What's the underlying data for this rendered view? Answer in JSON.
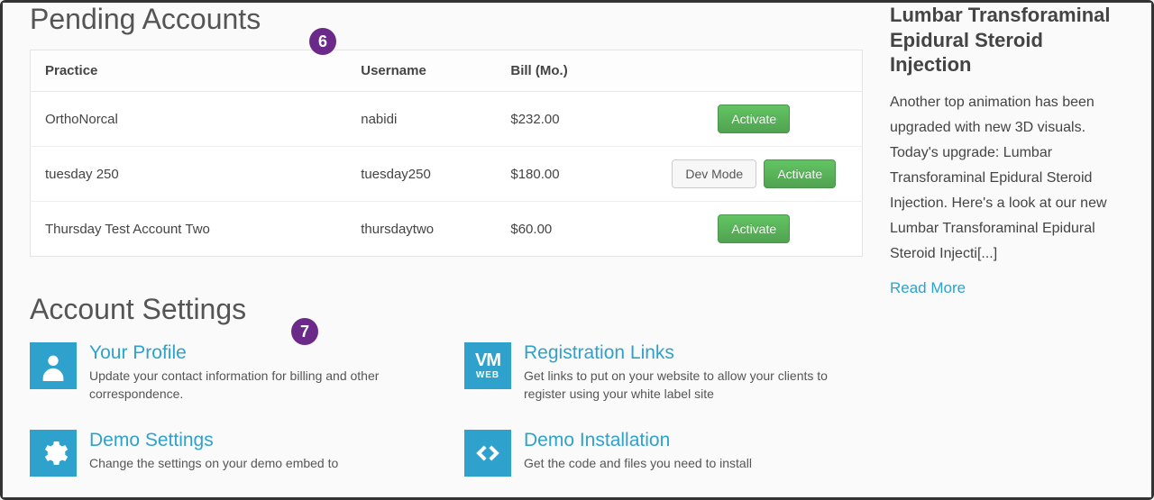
{
  "pending": {
    "title": "Pending Accounts",
    "badge": "6",
    "columns": {
      "practice": "Practice",
      "username": "Username",
      "bill": "Bill (Mo.)"
    },
    "rows": [
      {
        "practice": "OrthoNorcal",
        "username": "nabidi",
        "bill": "$232.00",
        "dev_mode": false
      },
      {
        "practice": "tuesday 250",
        "username": "tuesday250",
        "bill": "$180.00",
        "dev_mode": true
      },
      {
        "practice": "Thursday Test Account Two",
        "username": "thursdaytwo",
        "bill": "$60.00",
        "dev_mode": false
      }
    ],
    "buttons": {
      "activate": "Activate",
      "dev_mode": "Dev Mode"
    }
  },
  "settings": {
    "title": "Account Settings",
    "badge": "7",
    "items": [
      {
        "title": "Your Profile",
        "desc": "Update your contact information for billing and other correspondence."
      },
      {
        "title": "Registration Links",
        "desc": "Get links to put on your website to allow your clients to register using your white label site"
      },
      {
        "title": "Demo Settings",
        "desc": "Change the settings on your demo embed to"
      },
      {
        "title": "Demo Installation",
        "desc": "Get the code and files you need to install"
      }
    ]
  },
  "sidebar": {
    "post_title": "Lumbar Transforaminal Epidural Steroid Injection",
    "post_excerpt": "Another top animation has been upgraded with new 3D visuals. Today's upgrade: Lumbar Transforaminal Epidural Steroid Injection. Here's a look at our new Lumbar Transforaminal Epidural Steroid Injecti[...]",
    "read_more": "Read More"
  }
}
